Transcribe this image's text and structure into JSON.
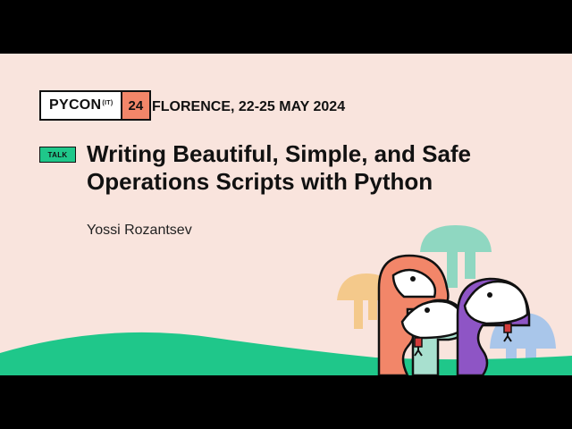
{
  "conference": {
    "logo_word": "PYCON",
    "logo_superscript": "(IT)",
    "logo_year": "24",
    "location_dates": "FLORENCE, 22-25 MAY 2024"
  },
  "talk": {
    "badge": "TALK",
    "title": "Writing Beautiful, Simple, and Safe Operations Scripts with Python",
    "speaker": "Yossi Rozantsev"
  },
  "colors": {
    "background": "#f9e4dd",
    "green": "#1fc78a",
    "coral": "#f28669",
    "mint": "#a8e0cf",
    "purple": "#8e55c5",
    "light_blue": "#a9c6ea",
    "sand": "#f4c98b",
    "teal_blob": "#8fd7c1"
  },
  "illustration": {
    "subject": "stylized cartoon snakes with forked tongues",
    "icons": [
      "snake-icon",
      "mushroom-tree-icon",
      "hill-wave"
    ]
  }
}
